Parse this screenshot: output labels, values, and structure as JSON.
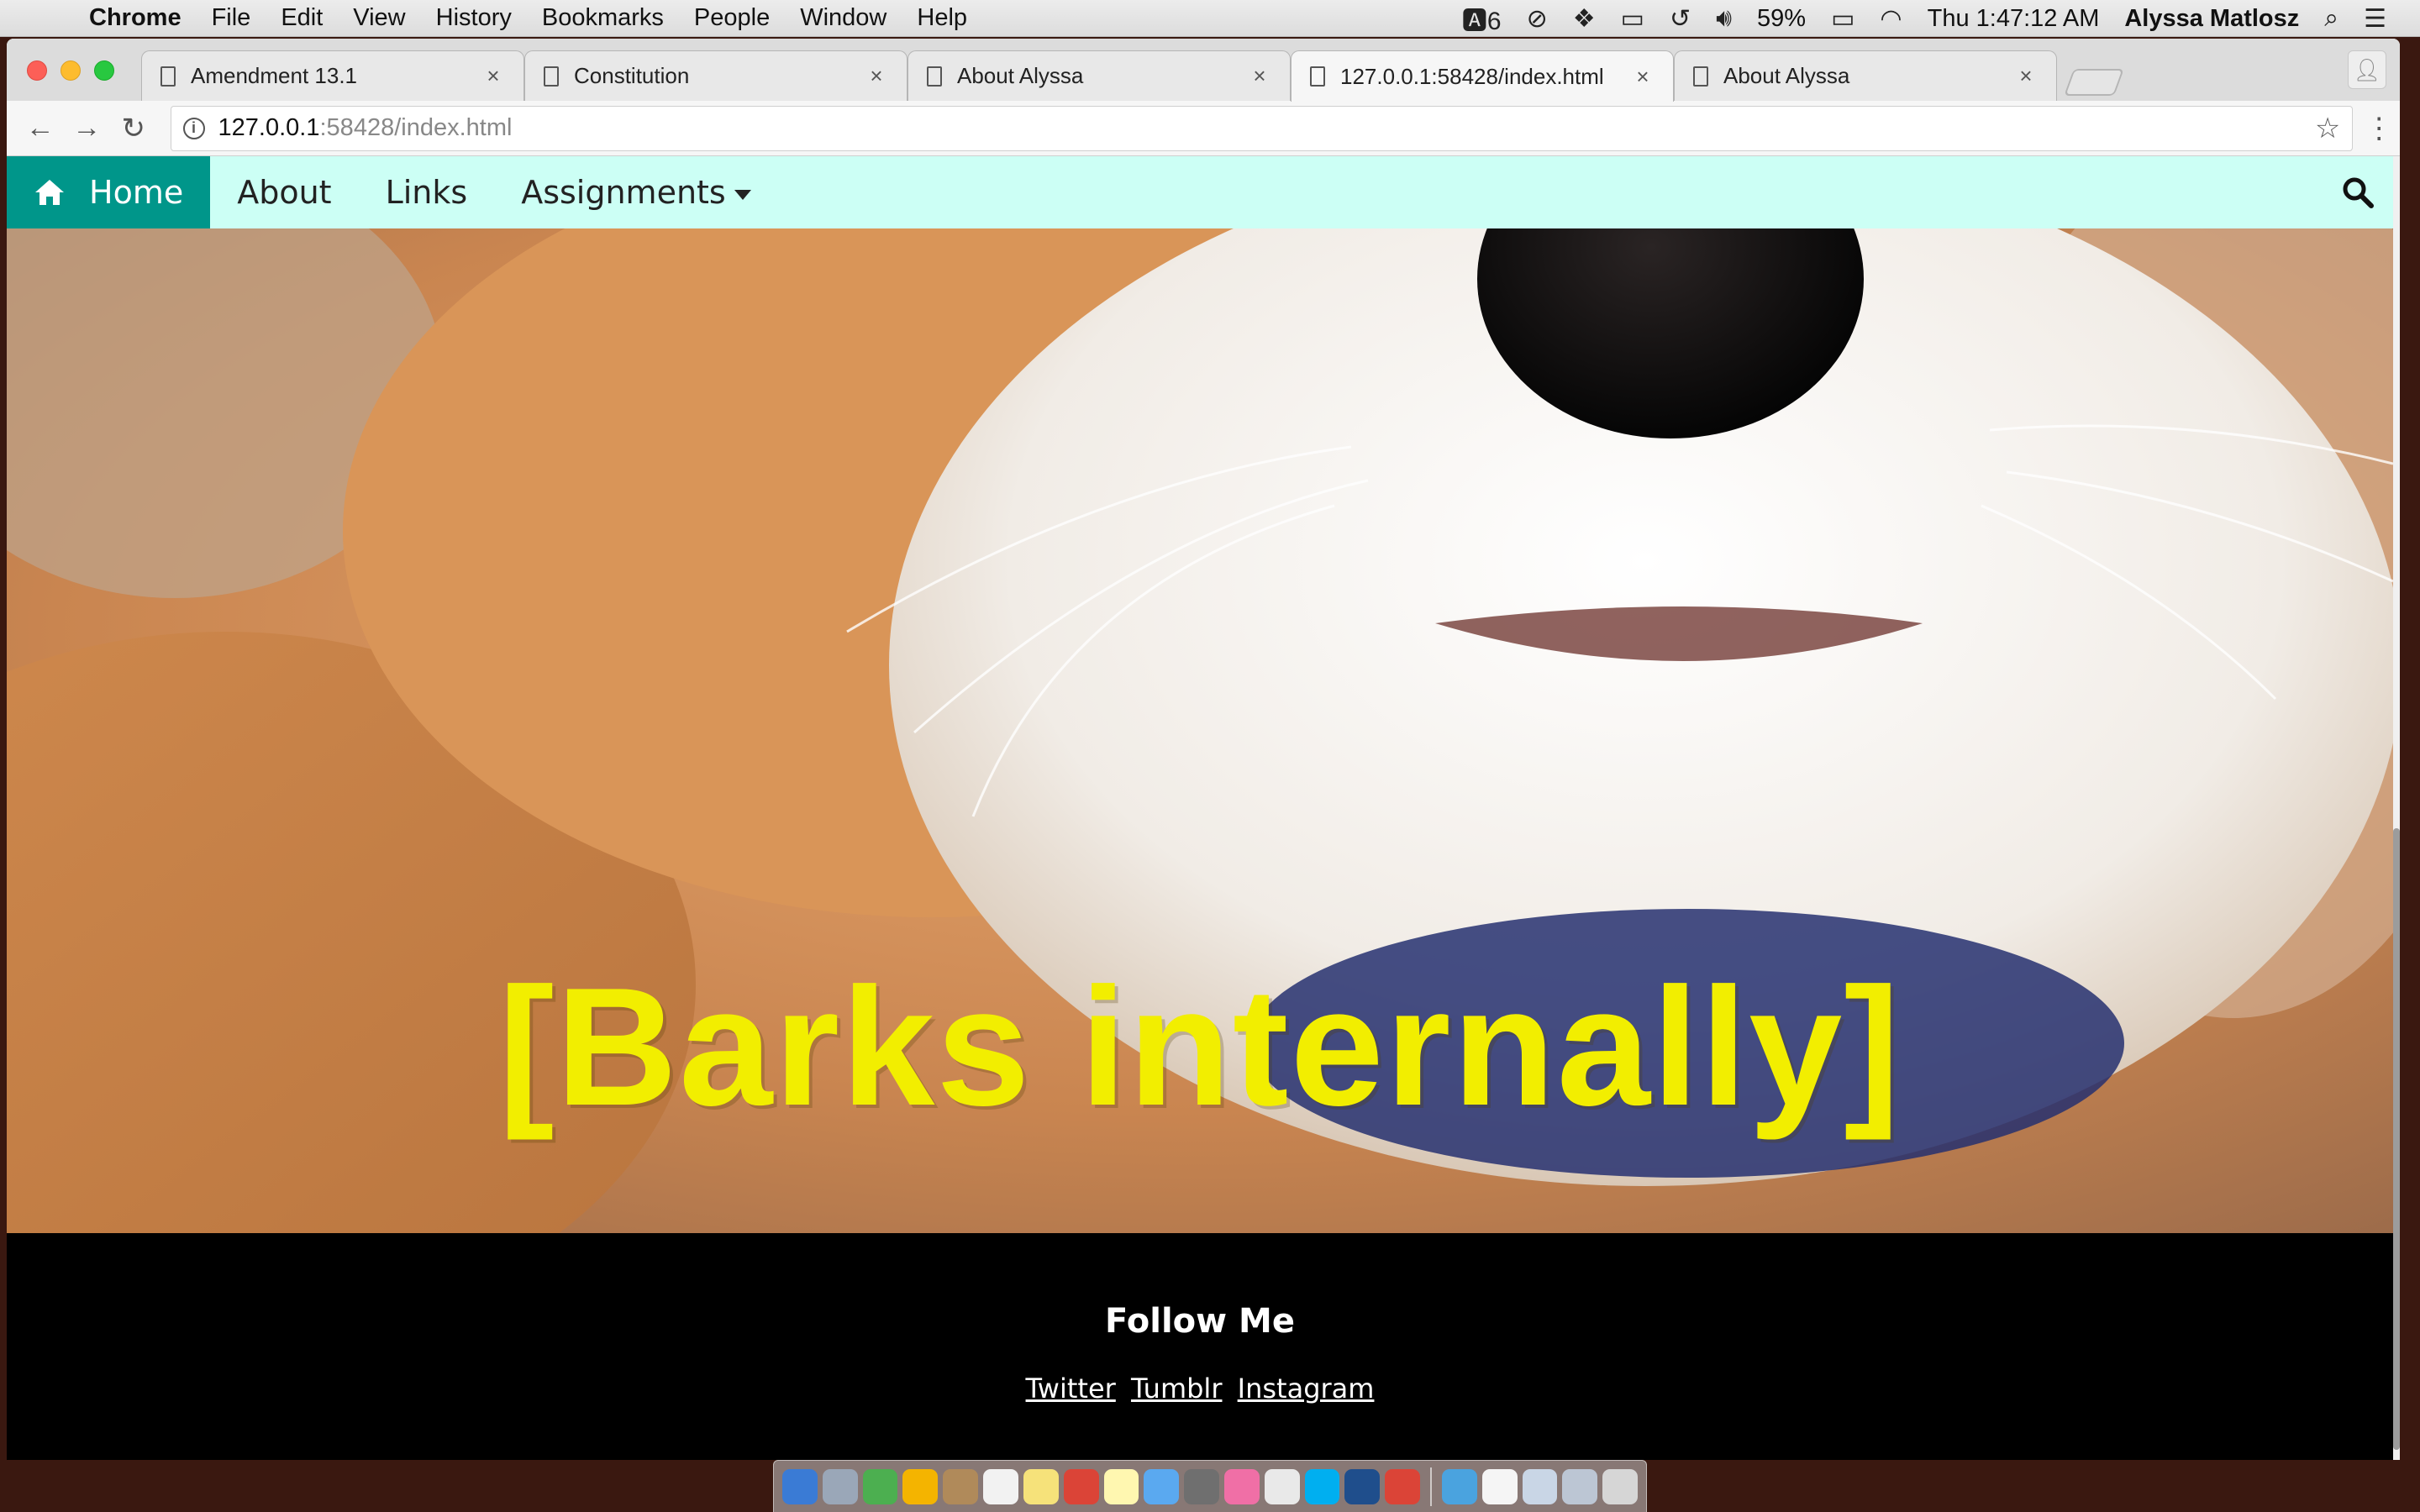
{
  "menubar": {
    "app_name": "Chrome",
    "items": [
      "File",
      "Edit",
      "View",
      "History",
      "Bookmarks",
      "People",
      "Window",
      "Help"
    ],
    "notification_count": "6",
    "battery": "59%",
    "clock": "Thu 1:47:12 AM",
    "user": "Alyssa Matlosz"
  },
  "tabs": [
    {
      "title": "Amendment 13.1",
      "active": false
    },
    {
      "title": "Constitution",
      "active": false
    },
    {
      "title": "About Alyssa",
      "active": false
    },
    {
      "title": "127.0.0.1:58428/index.html",
      "active": true
    },
    {
      "title": "About Alyssa",
      "active": false
    }
  ],
  "omnibox": {
    "host": "127.0.0.1",
    "path": ":58428/index.html"
  },
  "site": {
    "nav": {
      "home": "Home",
      "about": "About",
      "links": "Links",
      "assignments": "Assignments"
    },
    "hero_caption": "[Barks internally]",
    "footer": {
      "heading": "Follow Me",
      "links": [
        "Twitter",
        "Tumblr",
        "Instagram"
      ]
    }
  },
  "colors": {
    "nav_bg": "#ccfff5",
    "home_bg": "#00968a",
    "caption": "#f2ee00",
    "footer_bg": "#000000"
  }
}
